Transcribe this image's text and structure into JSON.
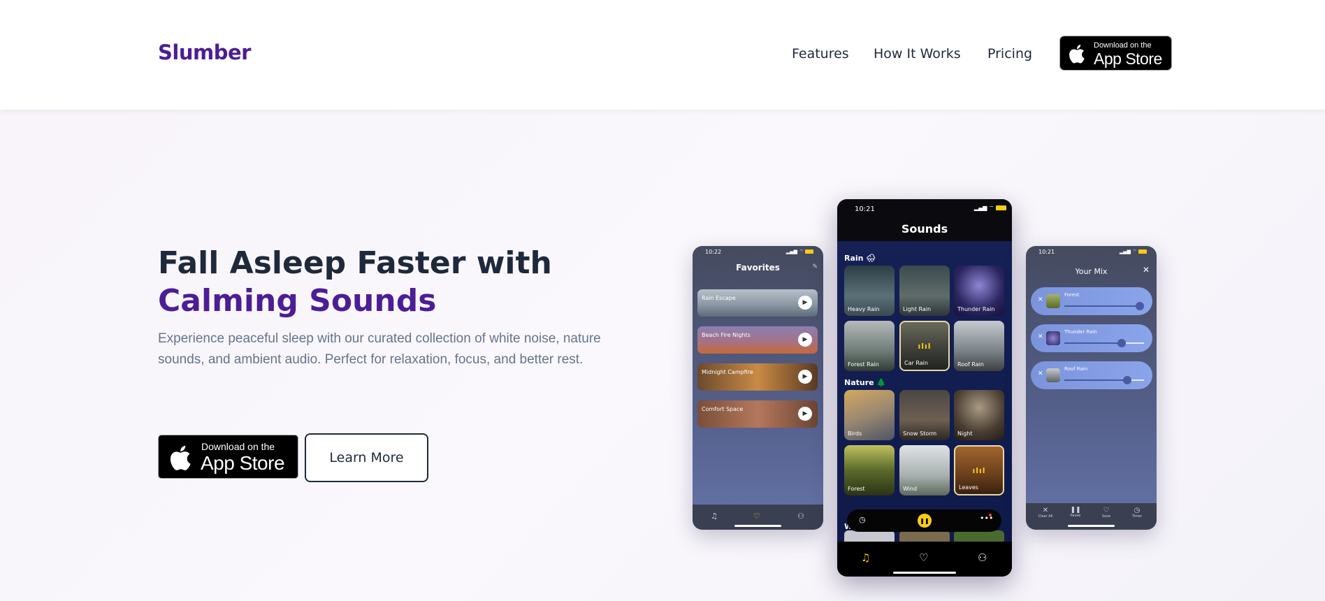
{
  "brand": {
    "name": "Slumber",
    "color": "#4c1d95"
  },
  "nav": {
    "links": [
      "Features",
      "How It Works",
      "Pricing"
    ],
    "cta": {
      "small": "Download on the",
      "big": "App Store"
    }
  },
  "hero": {
    "title_main": "Fall Asleep Faster with ",
    "title_accent": "Calming Sounds",
    "subtitle": "Experience peaceful sleep with our curated collection of white noise, nature sounds, and ambient audio. Perfect for relaxation, focus, and better rest.",
    "download": {
      "small": "Download on the",
      "big": "App Store"
    },
    "learn_more": "Learn More"
  },
  "phone_favorites": {
    "time": "10:22",
    "title": "Favorites",
    "items": [
      "Rain Escape",
      "Beach Fire Nights",
      "Midnight Campfire",
      "Comfort Space"
    ]
  },
  "phone_sounds": {
    "time": "10:21",
    "title": "Sounds",
    "sections": [
      {
        "label": "Rain 🌧",
        "tiles": [
          "Heavy Rain",
          "Light Rain",
          "Thunder Rain",
          "Forest Rain",
          "Car Rain",
          "Roof Rain"
        ]
      },
      {
        "label": "Nature 🌲",
        "tiles": [
          "Birds",
          "Snow Storm",
          "Night",
          "Forest",
          "Wind",
          "Leaves"
        ]
      }
    ],
    "partial_section": "W"
  },
  "phone_mix": {
    "time": "10:21",
    "title": "Your Mix",
    "items": [
      {
        "label": "Forest",
        "level": 0.95
      },
      {
        "label": "Thunder Rain",
        "level": 0.72
      },
      {
        "label": "Roof Rain",
        "level": 0.79
      }
    ],
    "tabs": [
      "Clear All",
      "Pause",
      "Save",
      "Timer"
    ]
  },
  "icons": [
    "apple-icon",
    "play-icon",
    "pause-icon",
    "music-note-icon",
    "heart-icon",
    "user-icon",
    "clock-icon",
    "more-icon",
    "close-icon",
    "edit-icon"
  ]
}
